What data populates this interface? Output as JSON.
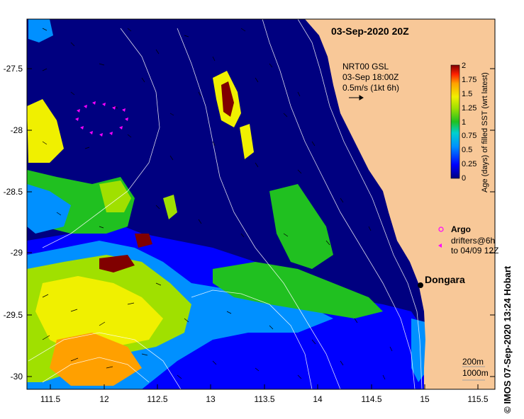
{
  "map": {
    "title": "03-Sep-2020 20Z",
    "product": {
      "line1": "NRT00 GSL",
      "line2": "03-Sep 18:00Z",
      "line3": "0.5m/s (1kt 6h)"
    },
    "colorbar": {
      "label": "Age (days) of filled SST (wrt latest)",
      "ticks": [
        "2",
        "1.75",
        "1.5",
        "1.25",
        "1",
        "0.75",
        "0.5",
        "0.25",
        "0"
      ],
      "colors": [
        "#000080",
        "#0000ff",
        "#0090ff",
        "#00d0d0",
        "#20c020",
        "#a0e000",
        "#f0f000",
        "#ffa000",
        "#ff2000",
        "#800000"
      ]
    },
    "legend": {
      "argo_label": "Argo",
      "drifters_line1": "drifters@6h",
      "drifters_line2": "to 04/09 12Z"
    },
    "place": {
      "name": "Dongara"
    },
    "contours": {
      "label1": "200m",
      "label2": "1000m"
    },
    "x_ticks": [
      "111.5",
      "12",
      "112.5",
      "13",
      "113.5",
      "14",
      "114.5",
      "15",
      "115.5"
    ],
    "y_ticks": [
      "-27.5",
      "-28",
      "-28.5",
      "-29",
      "-29.5",
      "-30"
    ],
    "credit": "© IMOS 07-Sep-2020 13:24 Hobart",
    "colors": {
      "land": "#f8c898",
      "ocean": "#000080",
      "argo": "#ff00ff"
    }
  }
}
